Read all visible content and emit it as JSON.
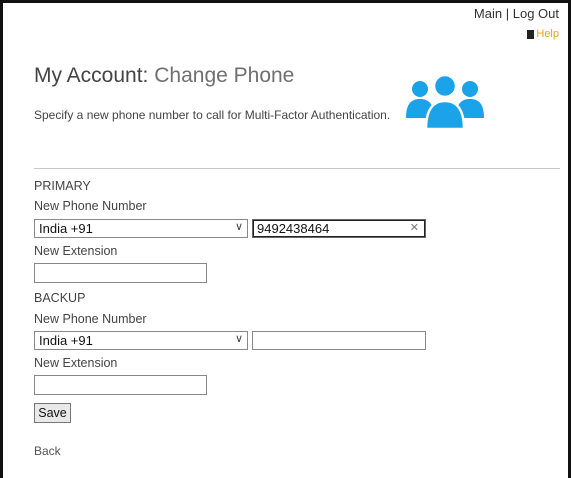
{
  "header": {
    "main_label": "Main",
    "separator": "|",
    "logout_label": "Log Out",
    "help_label": "Help"
  },
  "page": {
    "title_main": "My Account:",
    "title_sub": "Change Phone",
    "description": "Specify a new phone number to call for Multi-Factor Authentication."
  },
  "primary": {
    "section_label": "PRIMARY",
    "phone_label": "New Phone Number",
    "country_value": "India +91",
    "phone_value": "9492438464",
    "extension_label": "New Extension",
    "extension_value": ""
  },
  "backup": {
    "section_label": "BACKUP",
    "phone_label": "New Phone Number",
    "country_value": "India +91",
    "phone_value": "",
    "extension_label": "New Extension",
    "extension_value": ""
  },
  "actions": {
    "save_label": "Save",
    "back_label": "Back"
  },
  "colors": {
    "team_icon": "#1aa3e8",
    "help_text": "#e8a020"
  },
  "icons": {
    "team": "users-group-icon",
    "help": "help-icon",
    "chevron": "chevron-down-icon",
    "clear": "close-icon"
  }
}
